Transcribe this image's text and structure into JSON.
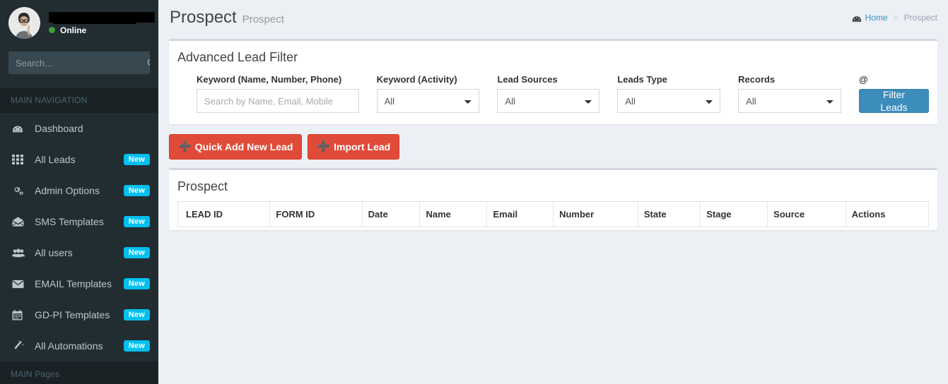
{
  "sidebar": {
    "user": {
      "name": "",
      "name_redacted": true,
      "status": "Online",
      "avatar_icon": "user-photo"
    },
    "search": {
      "placeholder": "Search...",
      "value": "",
      "icon": "search-icon"
    },
    "nav_header": "MAIN NAVIGATION",
    "pages_header": "MAIN Pages",
    "items": [
      {
        "label": "Dashboard",
        "icon": "dashboard-icon",
        "badge": ""
      },
      {
        "label": "All Leads",
        "icon": "grid-icon",
        "badge": "New"
      },
      {
        "label": "Admin Options",
        "icon": "gears-icon",
        "badge": "New"
      },
      {
        "label": "SMS Templates",
        "icon": "open-envelope-icon",
        "badge": "New"
      },
      {
        "label": "All users",
        "icon": "users-icon",
        "badge": "New"
      },
      {
        "label": "EMAIL Templates",
        "icon": "envelope-icon",
        "badge": "New"
      },
      {
        "label": "GD-PI Templates",
        "icon": "calendar-icon",
        "badge": "New"
      },
      {
        "label": "All Automations",
        "icon": "magic-wand-icon",
        "badge": "New"
      }
    ]
  },
  "header": {
    "title": "Prospect",
    "subtitle": "Prospect",
    "breadcrumb": {
      "home_label": "Home",
      "home_icon": "dashboard-icon",
      "separator": ">",
      "current": "Prospect"
    }
  },
  "filter_box": {
    "title": "Advanced Lead Filter",
    "fields": [
      {
        "label": "Keyword (Name, Number, Phone)",
        "type": "text",
        "placeholder": "Search by Name, Email, Mobile",
        "value": ""
      },
      {
        "label": "Keyword (Activity)",
        "type": "select",
        "value": "All"
      },
      {
        "label": "Lead Sources",
        "type": "select",
        "value": "All"
      },
      {
        "label": "Leads Type",
        "type": "select",
        "value": "All"
      },
      {
        "label": "Records",
        "type": "select",
        "value": "All"
      }
    ],
    "submit_label": "@",
    "submit_button": "Filter Leads",
    "accent_color": "#3c8dbc"
  },
  "actions": {
    "quick_add_label": "Quick Add New Lead",
    "import_label": "Import Lead",
    "plus_icon": "plus-icon",
    "color": "#e04b39"
  },
  "table_box": {
    "title": "Prospect",
    "columns": [
      "LEAD ID",
      "FORM ID",
      "Date",
      "Name",
      "Email",
      "Number",
      "State",
      "Stage",
      "Source",
      "Actions"
    ],
    "rows": []
  },
  "colors": {
    "sidebar_bg": "#222d32",
    "sidebar_header_bg": "#1a2226",
    "badge": "#00c0ef",
    "body_bg": "#ecf0f5",
    "primary": "#3c8dbc",
    "danger": "#e04b39",
    "online": "#3c9e3c"
  }
}
